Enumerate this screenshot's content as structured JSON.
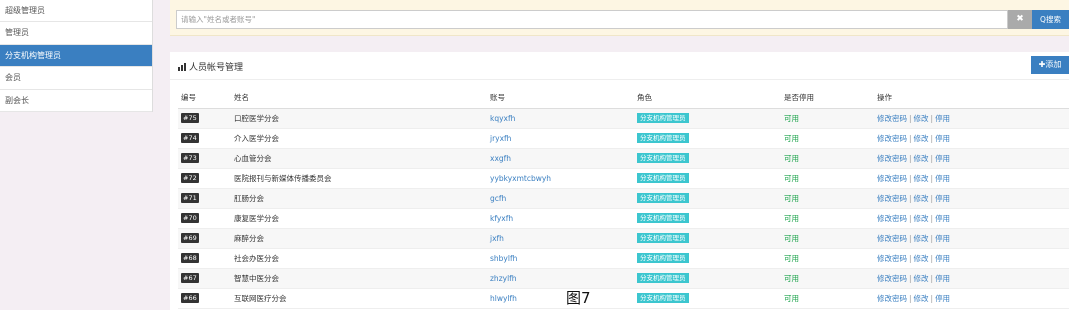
{
  "sidebar": {
    "items": [
      {
        "label": "超级管理员"
      },
      {
        "label": "管理员"
      },
      {
        "label": "分支机构管理员"
      },
      {
        "label": "会员"
      },
      {
        "label": "副会长"
      }
    ]
  },
  "search": {
    "placeholder": "请输入\"姓名或者账号\"",
    "clear_label": "✖",
    "button_label": "Q搜索"
  },
  "panel": {
    "title": "人员帐号管理",
    "add_label": "✚添加"
  },
  "table": {
    "headers": [
      "编号",
      "姓名",
      "账号",
      "角色",
      "是否停用",
      "操作"
    ],
    "rows": [
      {
        "id": "#75",
        "name": "口腔医学分会",
        "account": "kqyxfh",
        "role": "分支机构管理员",
        "status": "可用"
      },
      {
        "id": "#74",
        "name": "介入医学分会",
        "account": "jryxfh",
        "role": "分支机构管理员",
        "status": "可用"
      },
      {
        "id": "#73",
        "name": "心血管分会",
        "account": "xxgfh",
        "role": "分支机构管理员",
        "status": "可用"
      },
      {
        "id": "#72",
        "name": "医院报刊与新媒体传播委员会",
        "account": "yybkyxmtcbwyh",
        "role": "分支机构管理员",
        "status": "可用"
      },
      {
        "id": "#71",
        "name": "肛肠分会",
        "account": "gcfh",
        "role": "分支机构管理员",
        "status": "可用"
      },
      {
        "id": "#70",
        "name": "康复医学分会",
        "account": "kfyxfh",
        "role": "分支机构管理员",
        "status": "可用"
      },
      {
        "id": "#69",
        "name": "麻醉分会",
        "account": "jxfh",
        "role": "分支机构管理员",
        "status": "可用"
      },
      {
        "id": "#68",
        "name": "社会办医分会",
        "account": "shbylfh",
        "role": "分支机构管理员",
        "status": "可用"
      },
      {
        "id": "#67",
        "name": "智慧中医分会",
        "account": "zhzylfh",
        "role": "分支机构管理员",
        "status": "可用"
      },
      {
        "id": "#66",
        "name": "互联网医疗分会",
        "account": "hlwylfh",
        "role": "分支机构管理员",
        "status": "可用"
      }
    ],
    "actions": [
      "修改密码",
      "修改",
      "停用"
    ],
    "separator": "|"
  },
  "caption": "图7"
}
